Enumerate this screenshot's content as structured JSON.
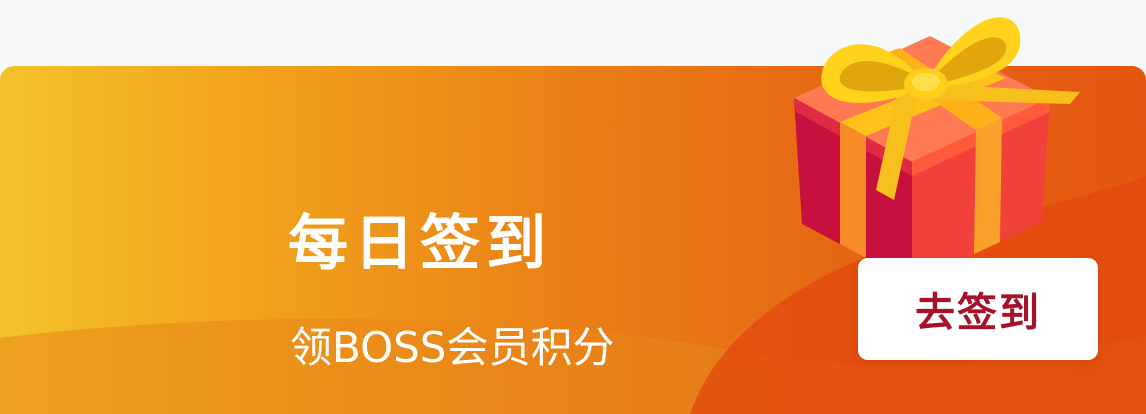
{
  "banner": {
    "title": "每日签到",
    "subtitle": "领BOSS会员积分",
    "button_label": "去签到",
    "gift_icon": "gift-box-icon"
  },
  "colors": {
    "gradient_start": "#f4c22a",
    "gradient_end": "#e45712",
    "button_text": "#a4132a",
    "button_bg": "#ffffff",
    "text_primary": "#ffffff"
  }
}
